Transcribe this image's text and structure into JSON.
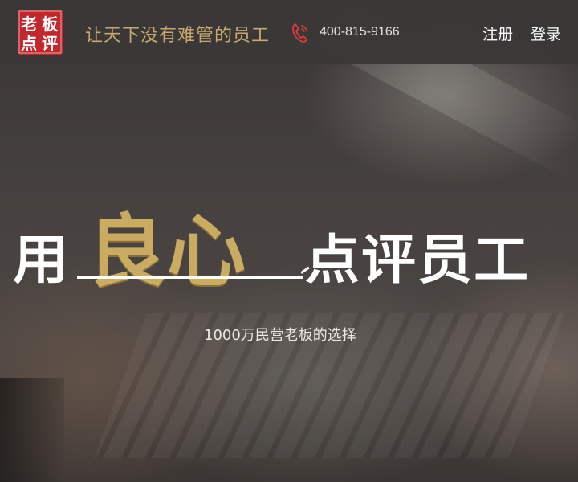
{
  "header": {
    "logo_text": "老板点评",
    "slogan": "让天下没有难管的员工",
    "phone_icon": "phone-icon",
    "phone_number": "400-815-9166",
    "nav": {
      "register": "注册",
      "login": "登录"
    }
  },
  "hero": {
    "title_part1": "用",
    "title_highlight": "良心",
    "title_part2": "点评员工",
    "subtitle": "1000万民营老板的选择"
  },
  "colors": {
    "accent_gold": "#c9ab62",
    "logo_red": "#c1272d",
    "header_bg": "#3a3837"
  }
}
